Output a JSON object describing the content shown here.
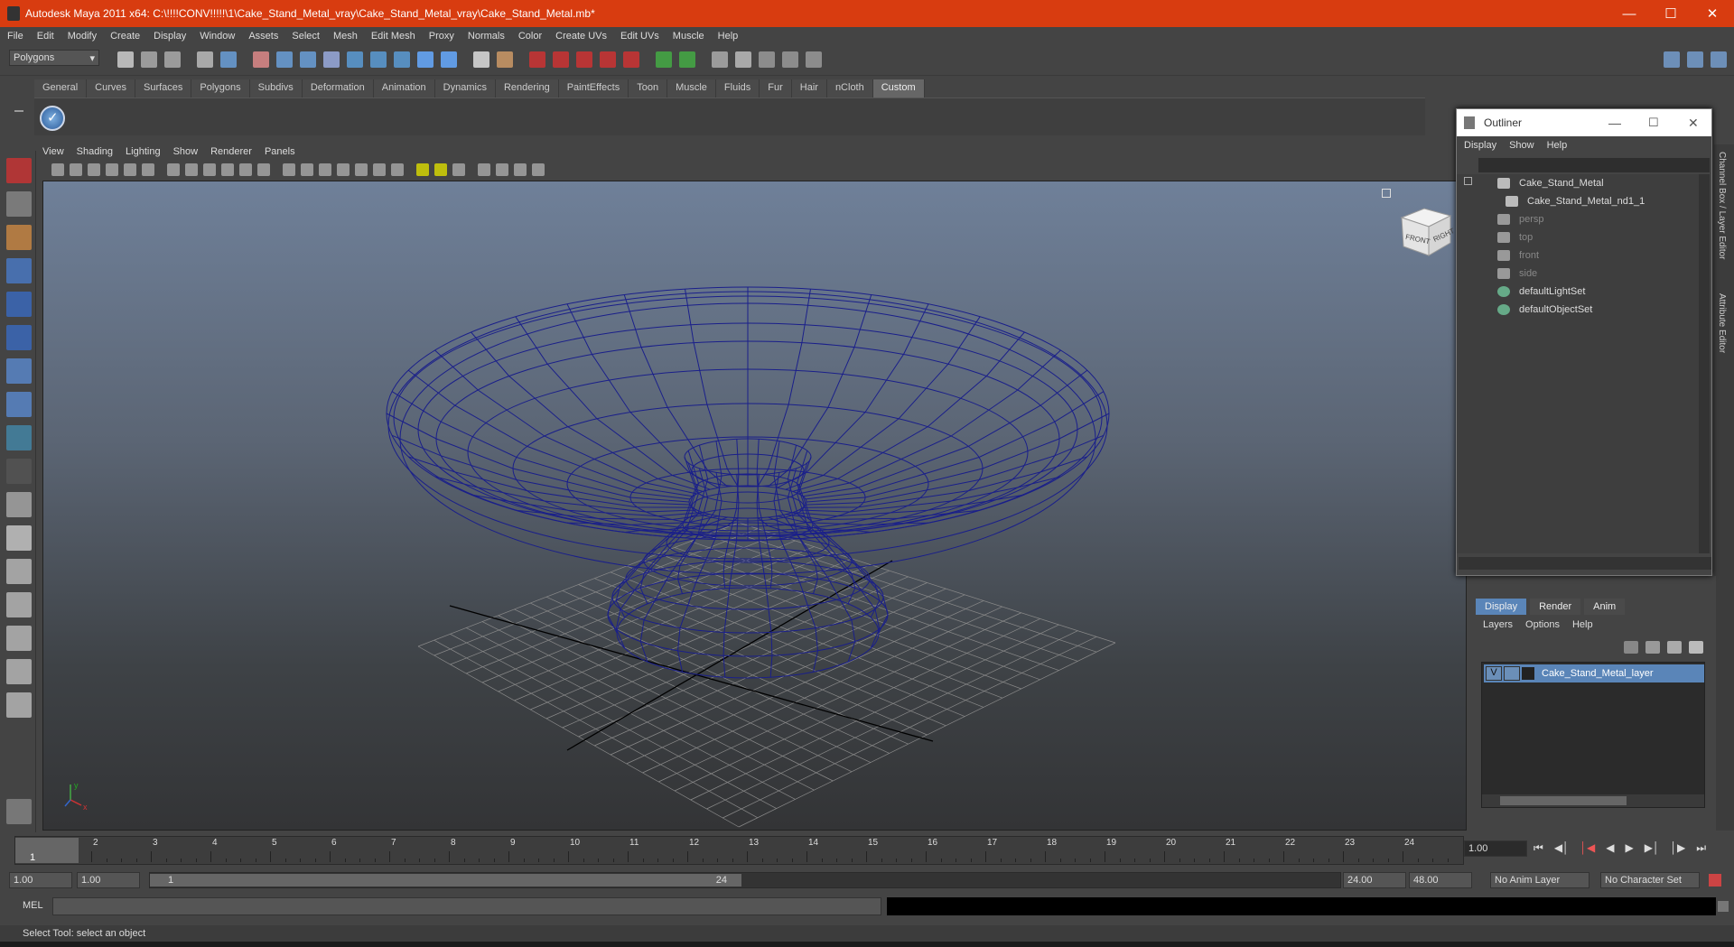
{
  "window": {
    "title": "Autodesk Maya 2011 x64: C:\\!!!!CONV!!!!!\\1\\Cake_Stand_Metal_vray\\Cake_Stand_Metal_vray\\Cake_Stand_Metal.mb*"
  },
  "menubar": [
    "File",
    "Edit",
    "Modify",
    "Create",
    "Display",
    "Window",
    "Assets",
    "Select",
    "Mesh",
    "Edit Mesh",
    "Proxy",
    "Normals",
    "Color",
    "Create UVs",
    "Edit UVs",
    "Muscle",
    "Help"
  ],
  "mode_selector": "Polygons",
  "shelf_tabs": [
    "General",
    "Curves",
    "Surfaces",
    "Polygons",
    "Subdivs",
    "Deformation",
    "Animation",
    "Dynamics",
    "Rendering",
    "PaintEffects",
    "Toon",
    "Muscle",
    "Fluids",
    "Fur",
    "Hair",
    "nCloth",
    "Custom"
  ],
  "active_shelf": "Custom",
  "panel_menu": [
    "View",
    "Shading",
    "Lighting",
    "Show",
    "Renderer",
    "Panels"
  ],
  "viewcube": {
    "front": "FRONT",
    "right": "RIGHT"
  },
  "outliner": {
    "title": "Outliner",
    "menu": [
      "Display",
      "Show",
      "Help"
    ],
    "items": [
      {
        "label": "Cake_Stand_Metal",
        "dim": false
      },
      {
        "label": "Cake_Stand_Metal_nd1_1",
        "dim": false
      },
      {
        "label": "persp",
        "dim": true
      },
      {
        "label": "top",
        "dim": true
      },
      {
        "label": "front",
        "dim": true
      },
      {
        "label": "side",
        "dim": true
      },
      {
        "label": "defaultLightSet",
        "dim": false
      },
      {
        "label": "defaultObjectSet",
        "dim": false
      }
    ]
  },
  "layer_editor": {
    "tabs": [
      "Display",
      "Render",
      "Anim"
    ],
    "menu": [
      "Layers",
      "Options",
      "Help"
    ],
    "layer": {
      "visible": "V",
      "name": "Cake_Stand_Metal_layer"
    }
  },
  "side_tabs": [
    "Channel Box / Layer Editor",
    "Attribute Editor"
  ],
  "timeslider": {
    "ticks": [
      "1",
      "2",
      "3",
      "4",
      "5",
      "6",
      "7",
      "8",
      "9",
      "10",
      "11",
      "12",
      "13",
      "14",
      "15",
      "16",
      "17",
      "18",
      "19",
      "20",
      "21",
      "22",
      "23",
      "24"
    ],
    "current": "1",
    "current_field": "1.00"
  },
  "range": {
    "start": "1.00",
    "inner_start": "1.00",
    "slider_start": "1",
    "slider_end": "24",
    "end": "24.00",
    "outer_end": "48.00",
    "anim_layer": "No Anim Layer",
    "char_set": "No Character Set"
  },
  "cmdline": {
    "label": "MEL"
  },
  "helpline": "Select Tool: select an object",
  "colors": {
    "titlebar": "#d83c10",
    "wire": "#1a1f8a",
    "accent": "#5a85b8"
  }
}
